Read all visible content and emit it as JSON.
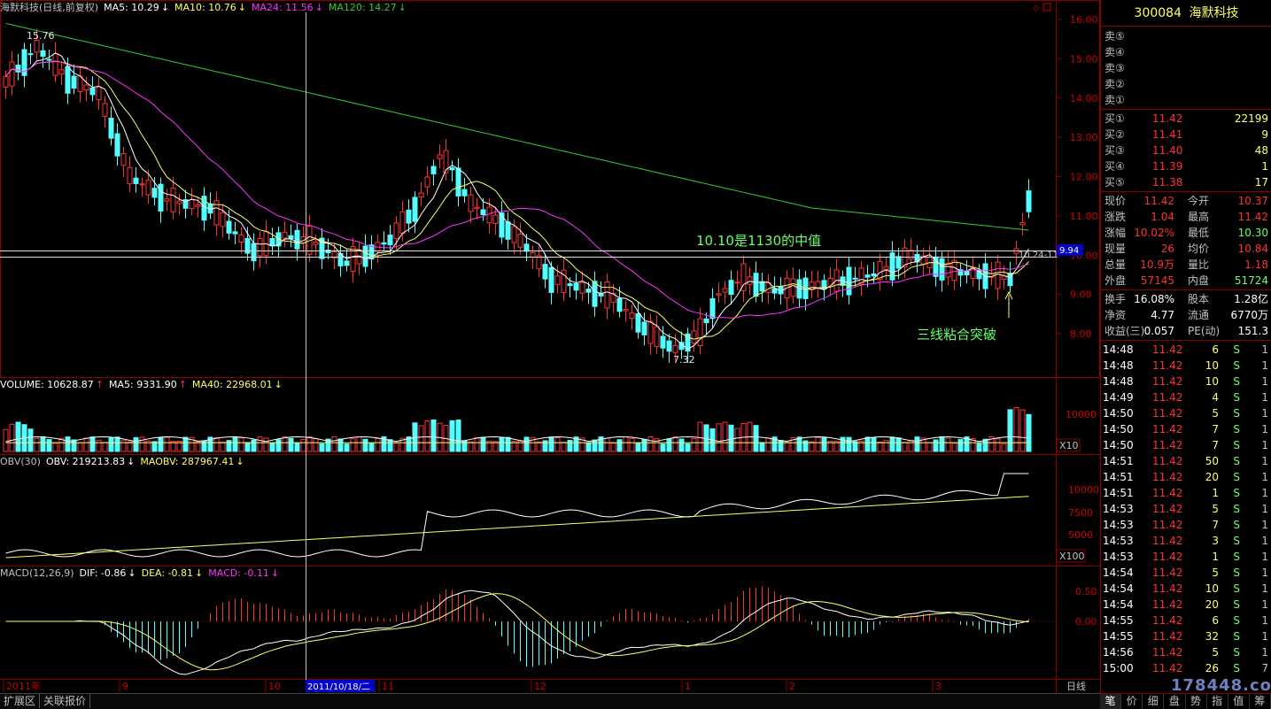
{
  "headers": {
    "main": {
      "name": "海默科技(日线,前复权)",
      "ma5": "MA5: 10.29",
      "ma10": "MA10: 10.76",
      "ma24": "MA24: 11.56",
      "ma120": "MA120: 14.27"
    },
    "volume": {
      "name": "VOLUME: 10628.87",
      "ma5": "MA5: 9331.90",
      "ma40": "MA40: 22968.01"
    },
    "obv": {
      "name": "OBV(30)",
      "obv": "OBV: 219213.83",
      "maobv": "MAOBV: 287967.41"
    },
    "macd": {
      "name": "MACD(12,26,9)",
      "dif": "DIF: -0.86",
      "dea": "DEA: -0.81",
      "macd": "MACD: -0.11"
    }
  },
  "price_axis": [
    "16.00",
    "15.00",
    "14.00",
    "13.00",
    "12.00",
    "11.00",
    "10.00",
    "9.00",
    "8.00"
  ],
  "price_flag": "9.94",
  "volume_axis": [
    "10000"
  ],
  "volume_scale": "X10",
  "obv_axis": [
    "10000",
    "7500",
    "5000"
  ],
  "obv_scale": "X100",
  "macd_axis": [
    "0.50",
    "0.00"
  ],
  "annotations": {
    "high": "15.76",
    "low": "7.32",
    "midpoint": "10.10是1130的中值",
    "breakout": "三线粘合突破",
    "lines_label": "10.24-11"
  },
  "x_axis": {
    "labels": [
      "2011年",
      "9",
      "10",
      "11",
      "12",
      "1",
      "2",
      "3"
    ],
    "cursor_date": "2011/10/18/二",
    "period": "日线"
  },
  "bottom_tabs": [
    "扩展区",
    "关联报价"
  ],
  "quote": {
    "code": "300084",
    "name": "海默科技",
    "sell": [
      {
        "label": "卖⑤"
      },
      {
        "label": "卖④"
      },
      {
        "label": "卖③"
      },
      {
        "label": "卖②"
      },
      {
        "label": "卖①"
      }
    ],
    "buy": [
      {
        "label": "买①",
        "price": "11.42",
        "vol": "22199"
      },
      {
        "label": "买②",
        "price": "11.41",
        "vol": "9"
      },
      {
        "label": "买③",
        "price": "11.40",
        "vol": "48"
      },
      {
        "label": "买④",
        "price": "11.39",
        "vol": "1"
      },
      {
        "label": "买⑤",
        "price": "11.38",
        "vol": "17"
      }
    ],
    "stats": [
      {
        "l1": "现价",
        "v1": "11.42",
        "l2": "今开",
        "v2": "10.37"
      },
      {
        "l1": "涨跌",
        "v1": "1.04",
        "l2": "最高",
        "v2": "11.42"
      },
      {
        "l1": "涨幅",
        "v1": "10.02%",
        "l2": "最低",
        "v2": "10.30"
      },
      {
        "l1": "现量",
        "v1": "26",
        "l2": "均价",
        "v2": "10.84"
      },
      {
        "l1": "总量",
        "v1": "10.9万",
        "l2": "量比",
        "v2": "1.18"
      },
      {
        "l1": "外盘",
        "v1": "57145",
        "l2": "内盘",
        "v2": "51724"
      }
    ],
    "fund": [
      {
        "l1": "换手",
        "v1": "16.08%",
        "l2": "股本",
        "v2": "1.28亿"
      },
      {
        "l1": "净资",
        "v1": "4.77",
        "l2": "流通",
        "v2": "6770万"
      },
      {
        "l1": "收益(三)",
        "v1": "0.057",
        "l2": "PE(动)",
        "v2": "151.3"
      }
    ],
    "ticks": [
      {
        "t": "14:48",
        "p": "11.42",
        "v": "6",
        "s": "S",
        "n": "1"
      },
      {
        "t": "14:48",
        "p": "11.42",
        "v": "10",
        "s": "S",
        "n": "1"
      },
      {
        "t": "14:48",
        "p": "11.42",
        "v": "10",
        "s": "S",
        "n": "1"
      },
      {
        "t": "14:49",
        "p": "11.42",
        "v": "4",
        "s": "S",
        "n": "1"
      },
      {
        "t": "14:50",
        "p": "11.42",
        "v": "5",
        "s": "S",
        "n": "1"
      },
      {
        "t": "14:50",
        "p": "11.42",
        "v": "7",
        "s": "S",
        "n": "1"
      },
      {
        "t": "14:50",
        "p": "11.42",
        "v": "7",
        "s": "S",
        "n": "1"
      },
      {
        "t": "14:51",
        "p": "11.42",
        "v": "50",
        "s": "S",
        "n": "1"
      },
      {
        "t": "14:51",
        "p": "11.42",
        "v": "20",
        "s": "S",
        "n": "1"
      },
      {
        "t": "14:51",
        "p": "11.42",
        "v": "1",
        "s": "S",
        "n": "1"
      },
      {
        "t": "14:53",
        "p": "11.42",
        "v": "5",
        "s": "S",
        "n": "1"
      },
      {
        "t": "14:53",
        "p": "11.42",
        "v": "7",
        "s": "S",
        "n": "1"
      },
      {
        "t": "14:53",
        "p": "11.42",
        "v": "3",
        "s": "S",
        "n": "1"
      },
      {
        "t": "14:53",
        "p": "11.42",
        "v": "1",
        "s": "S",
        "n": "1"
      },
      {
        "t": "14:54",
        "p": "11.42",
        "v": "5",
        "s": "S",
        "n": "1"
      },
      {
        "t": "14:54",
        "p": "11.42",
        "v": "10",
        "s": "S",
        "n": "1"
      },
      {
        "t": "14:54",
        "p": "11.42",
        "v": "20",
        "s": "S",
        "n": "1"
      },
      {
        "t": "14:55",
        "p": "11.42",
        "v": "6",
        "s": "S",
        "n": "1"
      },
      {
        "t": "14:55",
        "p": "11.42",
        "v": "32",
        "s": "S",
        "n": "1"
      },
      {
        "t": "14:56",
        "p": "11.42",
        "v": "5",
        "s": "S",
        "n": "1"
      },
      {
        "t": "15:00",
        "p": "11.42",
        "v": "26",
        "s": "S",
        "n": "7"
      }
    ],
    "tabs": [
      "笔",
      "价",
      "细",
      "盘",
      "势",
      "指",
      "值",
      "筹"
    ]
  },
  "watermark": "178448.com",
  "colors": {
    "up": "#ff3232",
    "down": "#54ffff",
    "ma5": "#ffffff",
    "ma10": "#ffff66",
    "ma24": "#ff33ff",
    "ma120": "#33cc33",
    "grid": "#8b0000",
    "annot": "#66ff66"
  }
}
